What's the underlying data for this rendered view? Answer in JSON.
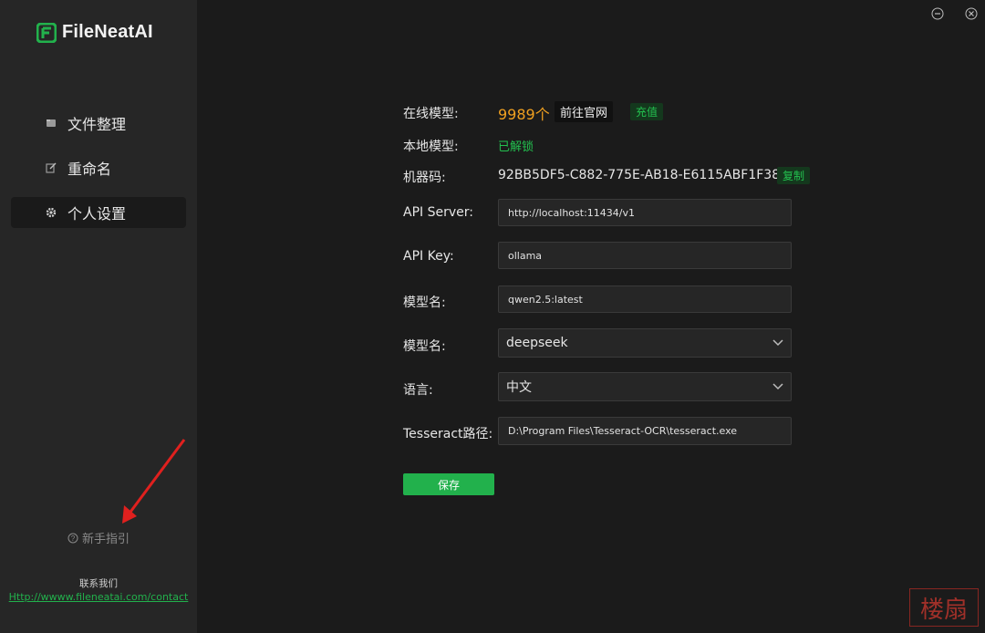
{
  "app": {
    "name": "FileNeatAI"
  },
  "sidebar": {
    "items": [
      {
        "label": "文件整理",
        "icon": "folder-icon"
      },
      {
        "label": "重命名",
        "icon": "edit-icon"
      },
      {
        "label": "个人设置",
        "icon": "gear-icon"
      }
    ],
    "active_index": 2,
    "guide_label": "新手指引",
    "contact_title": "联系我们",
    "contact_link": "Http://wwww.fileneatai.com/contact"
  },
  "settings": {
    "online_model": {
      "label": "在线模型:",
      "count": "9989个",
      "official_site_label": "前往官网",
      "recharge_label": "充值"
    },
    "local_model": {
      "label": "本地模型:",
      "status": "已解锁"
    },
    "machine_code": {
      "label": "机器码:",
      "value": "92BB5DF5-C882-775E-AB18-E6115ABF1F38",
      "copy_label": "复制"
    },
    "api_server": {
      "label": "API Server:",
      "value": "http://localhost:11434/v1"
    },
    "api_key": {
      "label": "API Key:",
      "value": "ollama"
    },
    "model_name_input": {
      "label": "模型名:",
      "value": "qwen2.5:latest"
    },
    "model_name_select": {
      "label": "模型名:",
      "value": "deepseek"
    },
    "language": {
      "label": "语言:",
      "value": "中文"
    },
    "tesseract": {
      "label": "Tesseract路径:",
      "value": "D:\\Program Files\\Tesseract-OCR\\tesseract.exe"
    },
    "save_label": "保存"
  },
  "colors": {
    "accent_green": "#22b14c",
    "count_orange": "#f0a020",
    "sidebar_bg": "#262626",
    "main_bg": "#1b1b1b",
    "annotation_red": "#e0201e"
  },
  "watermark": {
    "text": "楼扇"
  }
}
